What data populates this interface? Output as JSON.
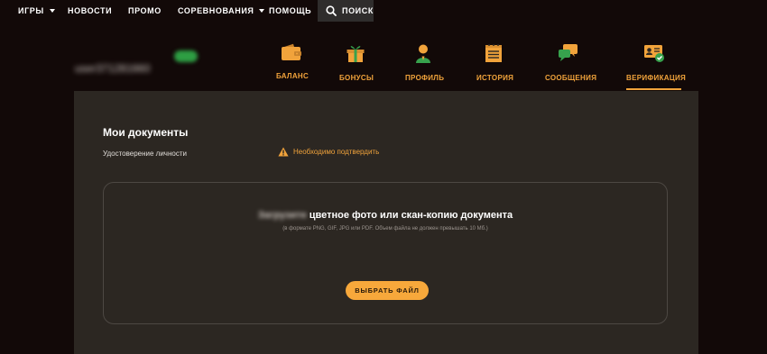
{
  "nav": {
    "games": "ИГРЫ",
    "news": "НОВОСТИ",
    "promo": "ПРОМО",
    "competitions": "СОРЕВНОВАНИЯ",
    "help": "ПОМОЩЬ",
    "search": "ПОИСК"
  },
  "user": {
    "name": "user371281660"
  },
  "tabs": [
    {
      "label": "БАЛАНС",
      "icon": "wallet-icon"
    },
    {
      "label": "БОНУСЫ",
      "icon": "gift-icon"
    },
    {
      "label": "ПРОФИЛЬ",
      "icon": "person-icon"
    },
    {
      "label": "ИСТОРИЯ",
      "icon": "notepad-icon"
    },
    {
      "label": "СООБЩЕНИЯ",
      "icon": "chat-icon"
    },
    {
      "label": "ВЕРИФИКАЦИЯ",
      "icon": "id-card-check-icon",
      "active": true
    }
  ],
  "documents": {
    "title": "Мои документы",
    "id_label": "Удостоверение личности",
    "status": "Необходимо подтвердить",
    "upload_prefix": "Загрузите",
    "upload_title": "цветное фото или скан-копию документа",
    "upload_hint": "(в формате PNG, GIF, JPG или PDF. Объем файла не должен превышать 10 Мб.)",
    "button": "ВЫБРАТЬ ФАЙЛ"
  },
  "colors": {
    "accent": "#f1a33b",
    "green": "#2e9e43",
    "panel": "#2c2722",
    "background": "#120908"
  }
}
